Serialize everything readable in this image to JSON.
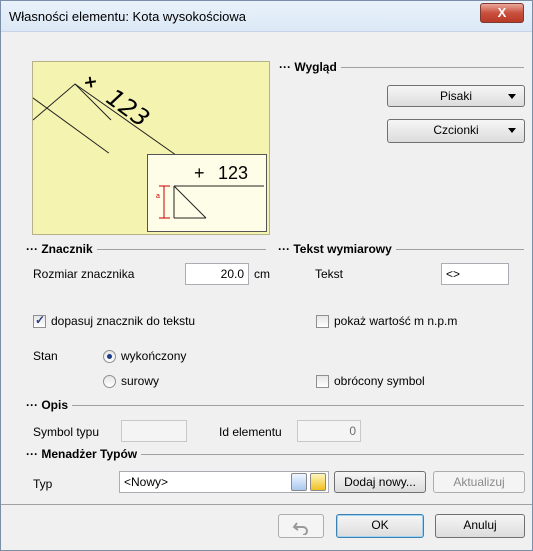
{
  "window": {
    "title": "Własności elementu: Kota wysokościowa",
    "close_label": "X"
  },
  "preview": {
    "label_big": "123",
    "label_small": "123",
    "plus": "+",
    "x_mark": "×",
    "a_mark": "a"
  },
  "wyglad": {
    "title": "Wygląd",
    "pens": "Pisaki",
    "fonts": "Czcionki"
  },
  "znacznik": {
    "title": "Znacznik",
    "size_label": "Rozmiar znacznika",
    "size_value": "20.0",
    "size_unit": "cm",
    "fit_label": "dopasuj znacznik do tekstu",
    "fit_checked": true,
    "state_label": "Stan",
    "state_finished": "wykończony",
    "state_raw": "surowy",
    "state_selected": "wykończony"
  },
  "tekst": {
    "title": "Tekst wymiarowy",
    "text_label": "Tekst",
    "text_value": "<>",
    "show_npm": "pokaż wartość m n.p.m",
    "show_npm_checked": false,
    "reversed": "obrócony symbol",
    "reversed_checked": false
  },
  "opis": {
    "title": "Opis",
    "symbol_label": "Symbol typu",
    "symbol_value": "",
    "id_label": "Id elementu",
    "id_value": "0"
  },
  "menedzer": {
    "title": "Menadżer Typów",
    "type_label": "Typ",
    "type_value": "<Nowy>",
    "add_new": "Dodaj nowy...",
    "update": "Aktualizuj"
  },
  "footer": {
    "ok": "OK",
    "cancel": "Anuluj"
  }
}
